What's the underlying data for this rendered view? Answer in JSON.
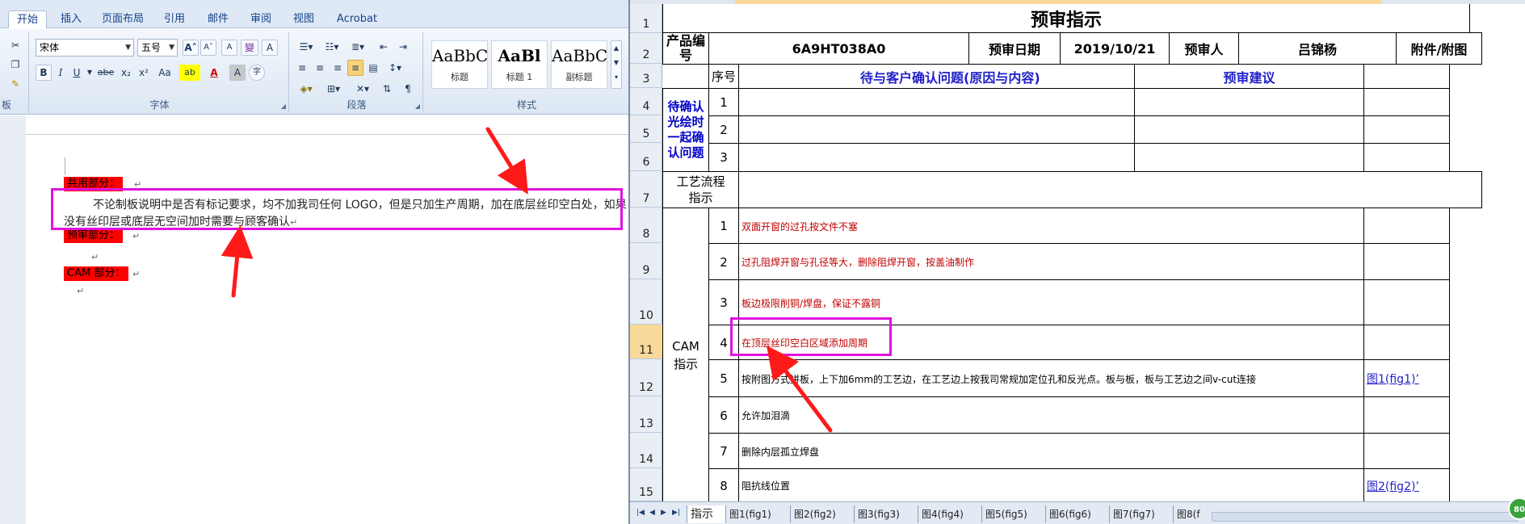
{
  "word": {
    "tabs": [
      "开始",
      "插入",
      "页面布局",
      "引用",
      "邮件",
      "审阅",
      "视图",
      "Acrobat"
    ],
    "ribbon": {
      "font_name": "宋体",
      "font_size": "五号",
      "font_group_label": "字体",
      "paragraph_group_label": "段落",
      "styles_group_label": "样式",
      "clipboard_group_label": "板",
      "styles": [
        {
          "preview": "AaBbC",
          "label": "标题"
        },
        {
          "preview": "AaBl",
          "label": "标题 1"
        },
        {
          "preview": "AaBbC",
          "label": "副标题"
        }
      ],
      "bold": "B",
      "italic": "I",
      "underline": "U",
      "strike": "abe",
      "sub": "x₂",
      "sup": "x²",
      "case": "Aa",
      "grow": "A",
      "shrink": "A",
      "clear": "A",
      "phonetic": "變",
      "border_char": "A",
      "highlight": "ab",
      "font_color": "A",
      "char_shade": "A",
      "enclose": "字"
    },
    "doc": {
      "heading_common": "共用部分：",
      "paragraph_line1": "不论制板说明中是否有标记要求，均不加我司任何 LOGO，但是只加生产周期，加在底层丝印空白处，如果",
      "paragraph_line2": "没有丝印层或底层无空间加时需要与顾客确认",
      "heading_prereview": "预审部分：",
      "heading_cam": "CAM 部分："
    },
    "para_mark": "↵"
  },
  "excel": {
    "row_headers": [
      "1",
      "2",
      "3",
      "4",
      "5",
      "6",
      "7",
      "8",
      "9",
      "10",
      "11",
      "12",
      "13",
      "14",
      "15"
    ],
    "selected_row": "11",
    "title": "预审指示",
    "product_no_label": "产品编号",
    "product_no": "6A9HT038A0",
    "review_date_label": "预审日期",
    "review_date": "2019/10/21",
    "reviewer_label": "预审人",
    "reviewer": "吕锦杨",
    "attachment_label": "附件/附图",
    "seq_label": "序号",
    "customer_issue_label": "待与客户确认问题(原因与内容)",
    "review_suggestion_label": "预审建议",
    "pending_group_label": "待确认光绘时一起确认问题",
    "pending_rows": [
      "1",
      "2",
      "3"
    ],
    "process_label": "工艺流程指示",
    "cam_label": "CAM指示",
    "cam_rows": [
      {
        "no": "1",
        "text": "双面开窗的过孔按文件不塞",
        "color": "red",
        "attachment": ""
      },
      {
        "no": "2",
        "text": "过孔阻焊开窗与孔径等大，删除阻焊开窗，按盖油制作",
        "color": "red",
        "attachment": ""
      },
      {
        "no": "3",
        "text": "板边极限削铜/焊盘，保证不露铜",
        "color": "red",
        "attachment": ""
      },
      {
        "no": "4",
        "text": "在顶层丝印空白区域添加周期",
        "color": "red",
        "attachment": ""
      },
      {
        "no": "5",
        "text": "按附图方式拼板，上下加6mm的工艺边，在工艺边上按我司常规加定位孔和反光点。板与板，板与工艺边之间v-cut连接",
        "color": "black",
        "attachment": "图1(fig1)’"
      },
      {
        "no": "6",
        "text": "允许加泪滴",
        "color": "black",
        "attachment": ""
      },
      {
        "no": "7",
        "text": "删除内层孤立焊盘",
        "color": "black",
        "attachment": ""
      },
      {
        "no": "8",
        "text": "阻抗线位置",
        "color": "black",
        "attachment": "图2(fig2)’"
      }
    ],
    "sheet_tabs": [
      "指示",
      "图1(fig1)",
      "图2(fig2)",
      "图3(fig3)",
      "图4(fig4)",
      "图5(fig5)",
      "图6(fig6)",
      "图7(fig7)",
      "图8(f"
    ],
    "active_sheet": "指示",
    "zoom_badge": "80"
  },
  "colors": {
    "highlight_magenta": "#e012e0",
    "arrow_red": "#ff1a1a",
    "heading_blue": "#1f1fc8",
    "cam_red_text": "#c00000",
    "selection_orange": "#f9d99a"
  }
}
